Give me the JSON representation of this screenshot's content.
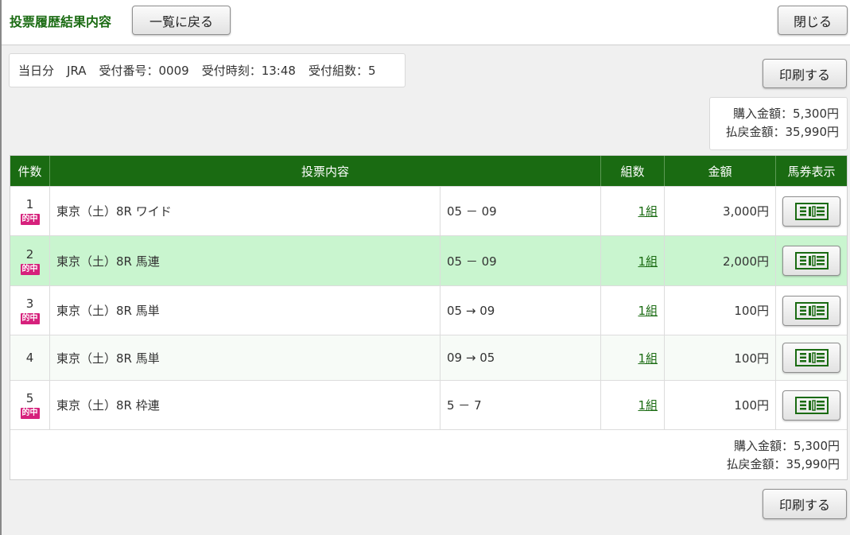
{
  "header": {
    "title": "投票履歴結果内容",
    "back_label": "一覧に戻る",
    "close_label": "閉じる"
  },
  "info": {
    "day": "当日分",
    "org": "JRA",
    "receipt_no": "受付番号：0009",
    "receipt_time": "受付時刻：13:48",
    "receipt_count": "受付組数：5"
  },
  "print_label": "印刷する",
  "summary": {
    "purchase": "購入金額：5,300円",
    "payout": "払戻金額：35,990円"
  },
  "table": {
    "headers": {
      "num": "件数",
      "content": "投票内容",
      "kumi": "組数",
      "amount": "金額",
      "view": "馬券表示"
    },
    "hit_label": "的中",
    "rows": [
      {
        "num": "1",
        "race": "東京（土）8R ワイド",
        "horses": "05 － 09",
        "kumi": "1組",
        "amount": "3,000円"
      },
      {
        "num": "2",
        "race": "東京（土）8R 馬連",
        "horses": "05 － 09",
        "kumi": "1組",
        "amount": "2,000円"
      },
      {
        "num": "3",
        "race": "東京（土）8R 馬単",
        "horses": "05 → 09",
        "kumi": "1組",
        "amount": "100円"
      },
      {
        "num": "4",
        "race": "東京（土）8R 馬単",
        "horses": "09 → 05",
        "kumi": "1組",
        "amount": "100円"
      },
      {
        "num": "5",
        "race": "東京（土）8R 枠連",
        "horses": "5 － 7",
        "kumi": "1組",
        "amount": "100円"
      }
    ]
  },
  "colors": {
    "brand_green": "#1a6b12",
    "hit_badge": "#d6217c",
    "highlight_row": "#c9f5cf"
  }
}
